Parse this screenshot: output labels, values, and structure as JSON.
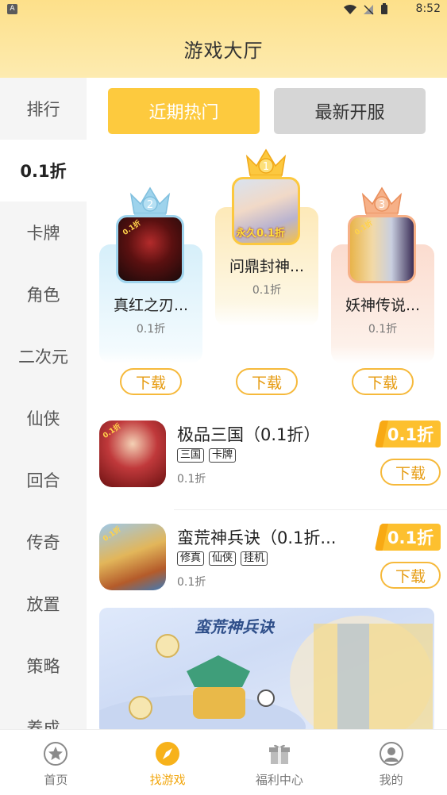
{
  "status_bar": {
    "time": "8:52",
    "badge": "A"
  },
  "header": {
    "title": "游戏大厅"
  },
  "sidebar": {
    "items": [
      {
        "label": "排行"
      },
      {
        "label": "0.1折",
        "active": true
      },
      {
        "label": "卡牌"
      },
      {
        "label": "角色"
      },
      {
        "label": "二次元"
      },
      {
        "label": "仙侠"
      },
      {
        "label": "回合"
      },
      {
        "label": "传奇"
      },
      {
        "label": "放置"
      },
      {
        "label": "策略"
      },
      {
        "label": "养成"
      }
    ]
  },
  "tabs": [
    {
      "label": "近期热门",
      "active": true
    },
    {
      "label": "最新开服",
      "active": false
    }
  ],
  "podium": [
    {
      "rank": "1",
      "name": "问鼎封神...",
      "discount": "0.1折",
      "button": "下载",
      "icon_text": "永久0.1折"
    },
    {
      "rank": "2",
      "name": "真红之刃...",
      "discount": "0.1折",
      "button": "下载",
      "icon_text": "0.1折"
    },
    {
      "rank": "3",
      "name": "妖神传说...",
      "discount": "0.1折",
      "button": "下载",
      "icon_text": "0.1折"
    }
  ],
  "games": [
    {
      "name": "极品三国（0.1折）",
      "tags": [
        "三国",
        "卡牌"
      ],
      "discount": "0.1折",
      "badge": "0.1折",
      "button": "下载"
    },
    {
      "name": "蛮荒神兵诀（0.1折...",
      "tags": [
        "修真",
        "仙侠",
        "挂机"
      ],
      "discount": "0.1折",
      "badge": "0.1折",
      "button": "下载"
    }
  ],
  "banner": {
    "title": "蛮荒神兵诀"
  },
  "bottom_nav": [
    {
      "label": "首页",
      "icon": "star-icon"
    },
    {
      "label": "找游戏",
      "icon": "compass-icon",
      "active": true
    },
    {
      "label": "福利中心",
      "icon": "gift-icon"
    },
    {
      "label": "我的",
      "icon": "user-icon"
    }
  ],
  "colors": {
    "accent": "#fdca3e",
    "header_bg": "#fde08a",
    "active_nav": "#f2a70f",
    "badge": "#fdc02f"
  }
}
